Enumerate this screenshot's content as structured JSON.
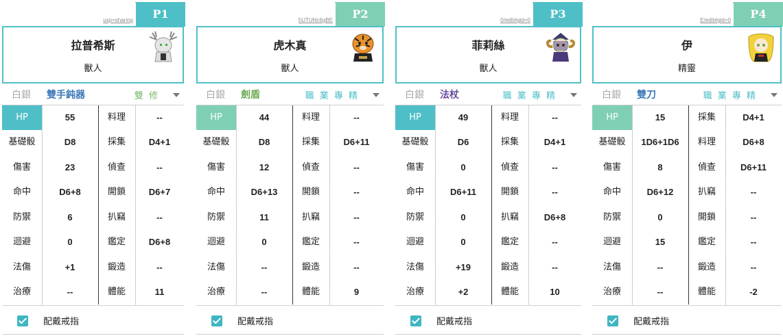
{
  "colors": {
    "accent_teal": "#4ebfc7",
    "accent_green": "#7fcfb4",
    "tab_p1": "#4ebfc7",
    "tab_p2": "#7fcfb4",
    "tab_p3": "#4ebfc7",
    "tab_p4": "#7fcfb4"
  },
  "stat_labels": [
    "HP",
    "基礎骰",
    "傷害",
    "命中",
    "防禦",
    "迴避",
    "法傷",
    "治療"
  ],
  "players": [
    {
      "tab": "P1",
      "url": "usp=sharing",
      "name": "拉普希斯",
      "race": "獸人",
      "silver": "白銀",
      "weapon": "雙手鈍器",
      "weapon_color": "#3b78b8",
      "specialty": "雙 修",
      "spec_color": "#7ab86a",
      "ring_label": "配戴戒指",
      "avatar_icon": "white-haired-antlered-character-icon",
      "stats": [
        "55",
        "D8",
        "23",
        "D6+8",
        "6",
        "0",
        "+1",
        "--"
      ],
      "skill_labels": [
        "料理",
        "採集",
        "偵查",
        "開鎖",
        "扒竊",
        "鑑定",
        "鍛造",
        "體能"
      ],
      "skill_values": [
        "--",
        "D4+1",
        "--",
        "D6+7",
        "--",
        "D6+8",
        "--",
        "11"
      ]
    },
    {
      "tab": "P2",
      "url": "5UTUNc6gBE",
      "name": "虎木真",
      "race": "獸人",
      "silver": "白銀",
      "weapon": "劍盾",
      "weapon_color": "#6aa84f",
      "specialty": "職 業 專 精",
      "spec_color": "#4ebfc7",
      "ring_label": "配戴戒指",
      "avatar_icon": "tiger-character-icon",
      "stats": [
        "44",
        "D8",
        "12",
        "D6+13",
        "11",
        "0",
        "--",
        "--"
      ],
      "skill_labels": [
        "料理",
        "採集",
        "偵查",
        "開鎖",
        "扒竊",
        "鑑定",
        "鍛造",
        "體能"
      ],
      "skill_values": [
        "--",
        "D6+11",
        "--",
        "--",
        "--",
        "--",
        "--",
        "9"
      ]
    },
    {
      "tab": "P3",
      "url": "0/edit#gid=0",
      "name": "菲莉絲",
      "race": "獸人",
      "silver": "白銀",
      "weapon": "法杖",
      "weapon_color": "#6a4c9c",
      "specialty": "職 業 專 精",
      "spec_color": "#4ebfc7",
      "ring_label": "配戴戒指",
      "avatar_icon": "ram-horned-mage-character-icon",
      "stats": [
        "49",
        "D6",
        "0",
        "D6+11",
        "0",
        "0",
        "+19",
        "+2"
      ],
      "skill_labels": [
        "料理",
        "採集",
        "偵查",
        "開鎖",
        "扒竊",
        "鑑定",
        "鍛造",
        "體能"
      ],
      "skill_values": [
        "--",
        "D4+1",
        "--",
        "--",
        "D6+8",
        "--",
        "--",
        "10"
      ]
    },
    {
      "tab": "P4",
      "url": "E/edit#gid=0",
      "name": "伊",
      "race": "精靈",
      "silver": "白銀",
      "weapon": "雙刀",
      "weapon_color": "#3b78b8",
      "specialty": "職 業 專 精",
      "spec_color": "#4ebfc7",
      "ring_label": "配戴戒指",
      "avatar_icon": "blonde-elf-character-icon",
      "stats": [
        "15",
        "1D6+1D6",
        "8",
        "D6+12",
        "0",
        "15",
        "--",
        "--"
      ],
      "skill_labels": [
        "採集",
        "料理",
        "偵查",
        "扒竊",
        "開鎖",
        "鑑定",
        "鍛造",
        "體能"
      ],
      "skill_values": [
        "D4+1",
        "D6+8",
        "D6+11",
        "--",
        "--",
        "--",
        "--",
        "-2"
      ]
    }
  ]
}
